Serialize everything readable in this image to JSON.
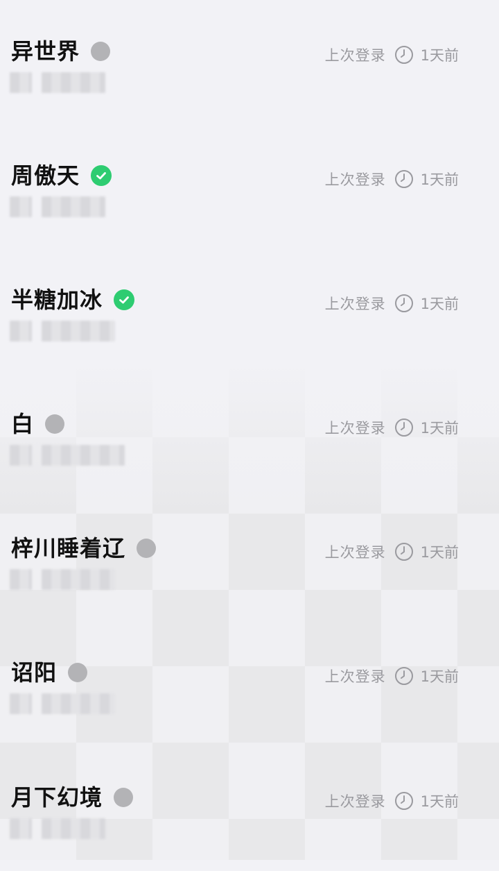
{
  "users": [
    {
      "name": "异世界",
      "status": "offline",
      "last_login_label": "上次登录",
      "last_login_time": "1天前"
    },
    {
      "name": "周傲天",
      "status": "verified",
      "last_login_label": "上次登录",
      "last_login_time": "1天前"
    },
    {
      "name": "半糖加冰",
      "status": "verified",
      "last_login_label": "上次登录",
      "last_login_time": "1天前"
    },
    {
      "name": "白",
      "status": "offline",
      "last_login_label": "上次登录",
      "last_login_time": "1天前"
    },
    {
      "name": "梓川睡着辽",
      "status": "offline",
      "last_login_label": "上次登录",
      "last_login_time": "1天前"
    },
    {
      "name": "诏阳",
      "status": "offline",
      "last_login_label": "上次登录",
      "last_login_time": "1天前"
    },
    {
      "name": "月下幻境",
      "status": "offline",
      "last_login_label": "上次登录",
      "last_login_time": "1天前"
    }
  ],
  "colors": {
    "verified": "#2ecc71",
    "offline": "#b3b3b6",
    "meta_text": "#9a9a9f",
    "name_text": "#111111"
  },
  "icons": {
    "status_offline": "gray-dot-icon",
    "status_verified": "check-circle-icon",
    "last_login": "clock-icon"
  }
}
